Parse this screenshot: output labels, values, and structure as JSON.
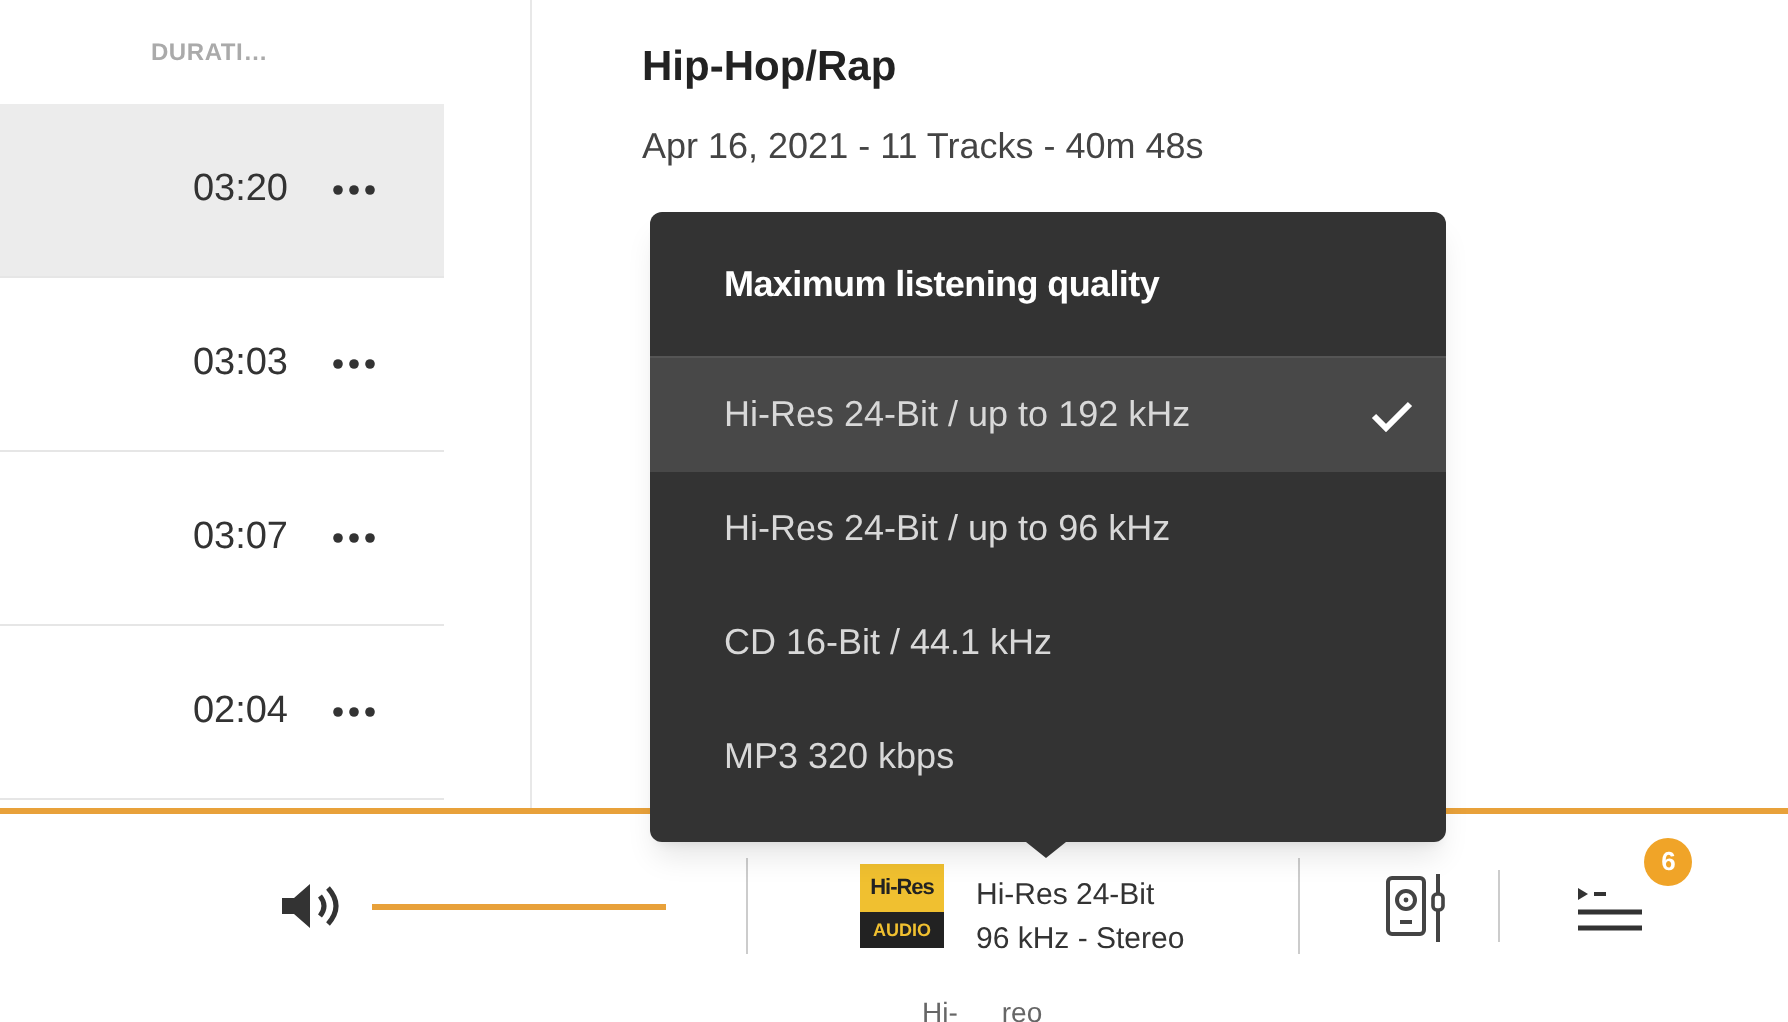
{
  "track_list": {
    "column_header": "DURATI…",
    "rows": [
      {
        "duration": "03:20",
        "selected": true
      },
      {
        "duration": "03:03",
        "selected": false
      },
      {
        "duration": "03:07",
        "selected": false
      },
      {
        "duration": "02:04",
        "selected": false
      }
    ]
  },
  "album": {
    "genre": "Hip-Hop/Rap",
    "details": "Apr 16, 2021 - 11 Tracks - 40m 48s"
  },
  "playback_progress": {
    "level": 1
  },
  "quality_menu": {
    "title": "Maximum listening quality",
    "options": [
      {
        "label": "Hi-Res 24-Bit / up to 192 kHz",
        "selected": true
      },
      {
        "label": "Hi-Res 24-Bit / up to 96 kHz",
        "selected": false
      },
      {
        "label": "CD 16-Bit / 44.1 kHz",
        "selected": false
      },
      {
        "label": "MP3 320 kbps",
        "selected": false
      }
    ]
  },
  "player_bar": {
    "volume": {
      "level": 1
    },
    "quality_logo": {
      "top": "Hi-Res",
      "bottom": "AUDIO"
    },
    "quality_line_1": "Hi-Res 24-Bit",
    "quality_line_2": "96 kHz - Stereo",
    "tooltip_fragments": [
      "Hi-",
      "reo"
    ],
    "queue_badge": "6"
  }
}
